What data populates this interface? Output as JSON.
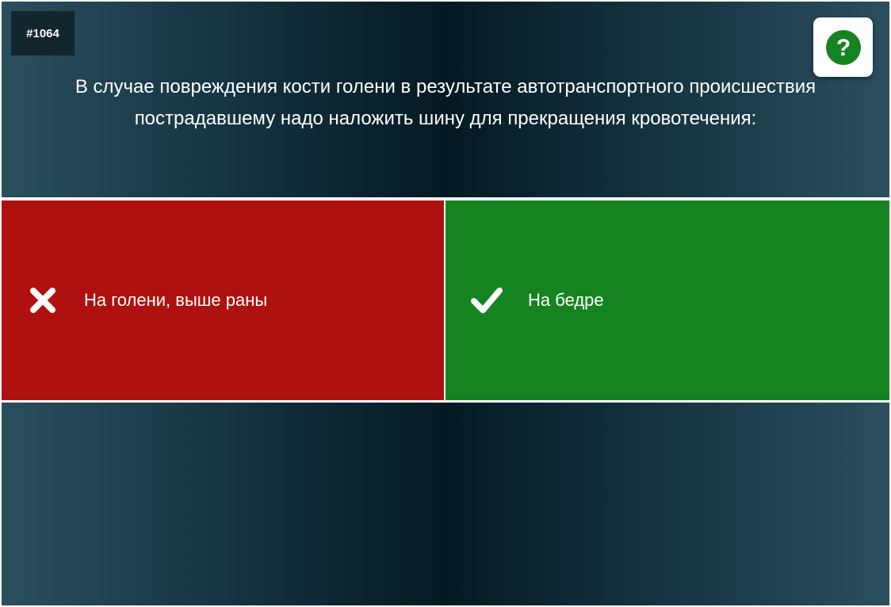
{
  "question": {
    "id_label": "#1064",
    "text": "В случае повреждения кости голени в результате автотранспортного происшествия пострадавшему надо наложить шину для прекращения кровотечения:"
  },
  "help_button": {
    "icon": "question-circle-icon",
    "color": "#168321"
  },
  "answers": [
    {
      "label": "На голени, выше раны",
      "status": "wrong",
      "icon": "cross-icon",
      "color": "#ae110f"
    },
    {
      "label": "На бедре",
      "status": "correct",
      "icon": "check-icon",
      "color": "#168321"
    }
  ]
}
